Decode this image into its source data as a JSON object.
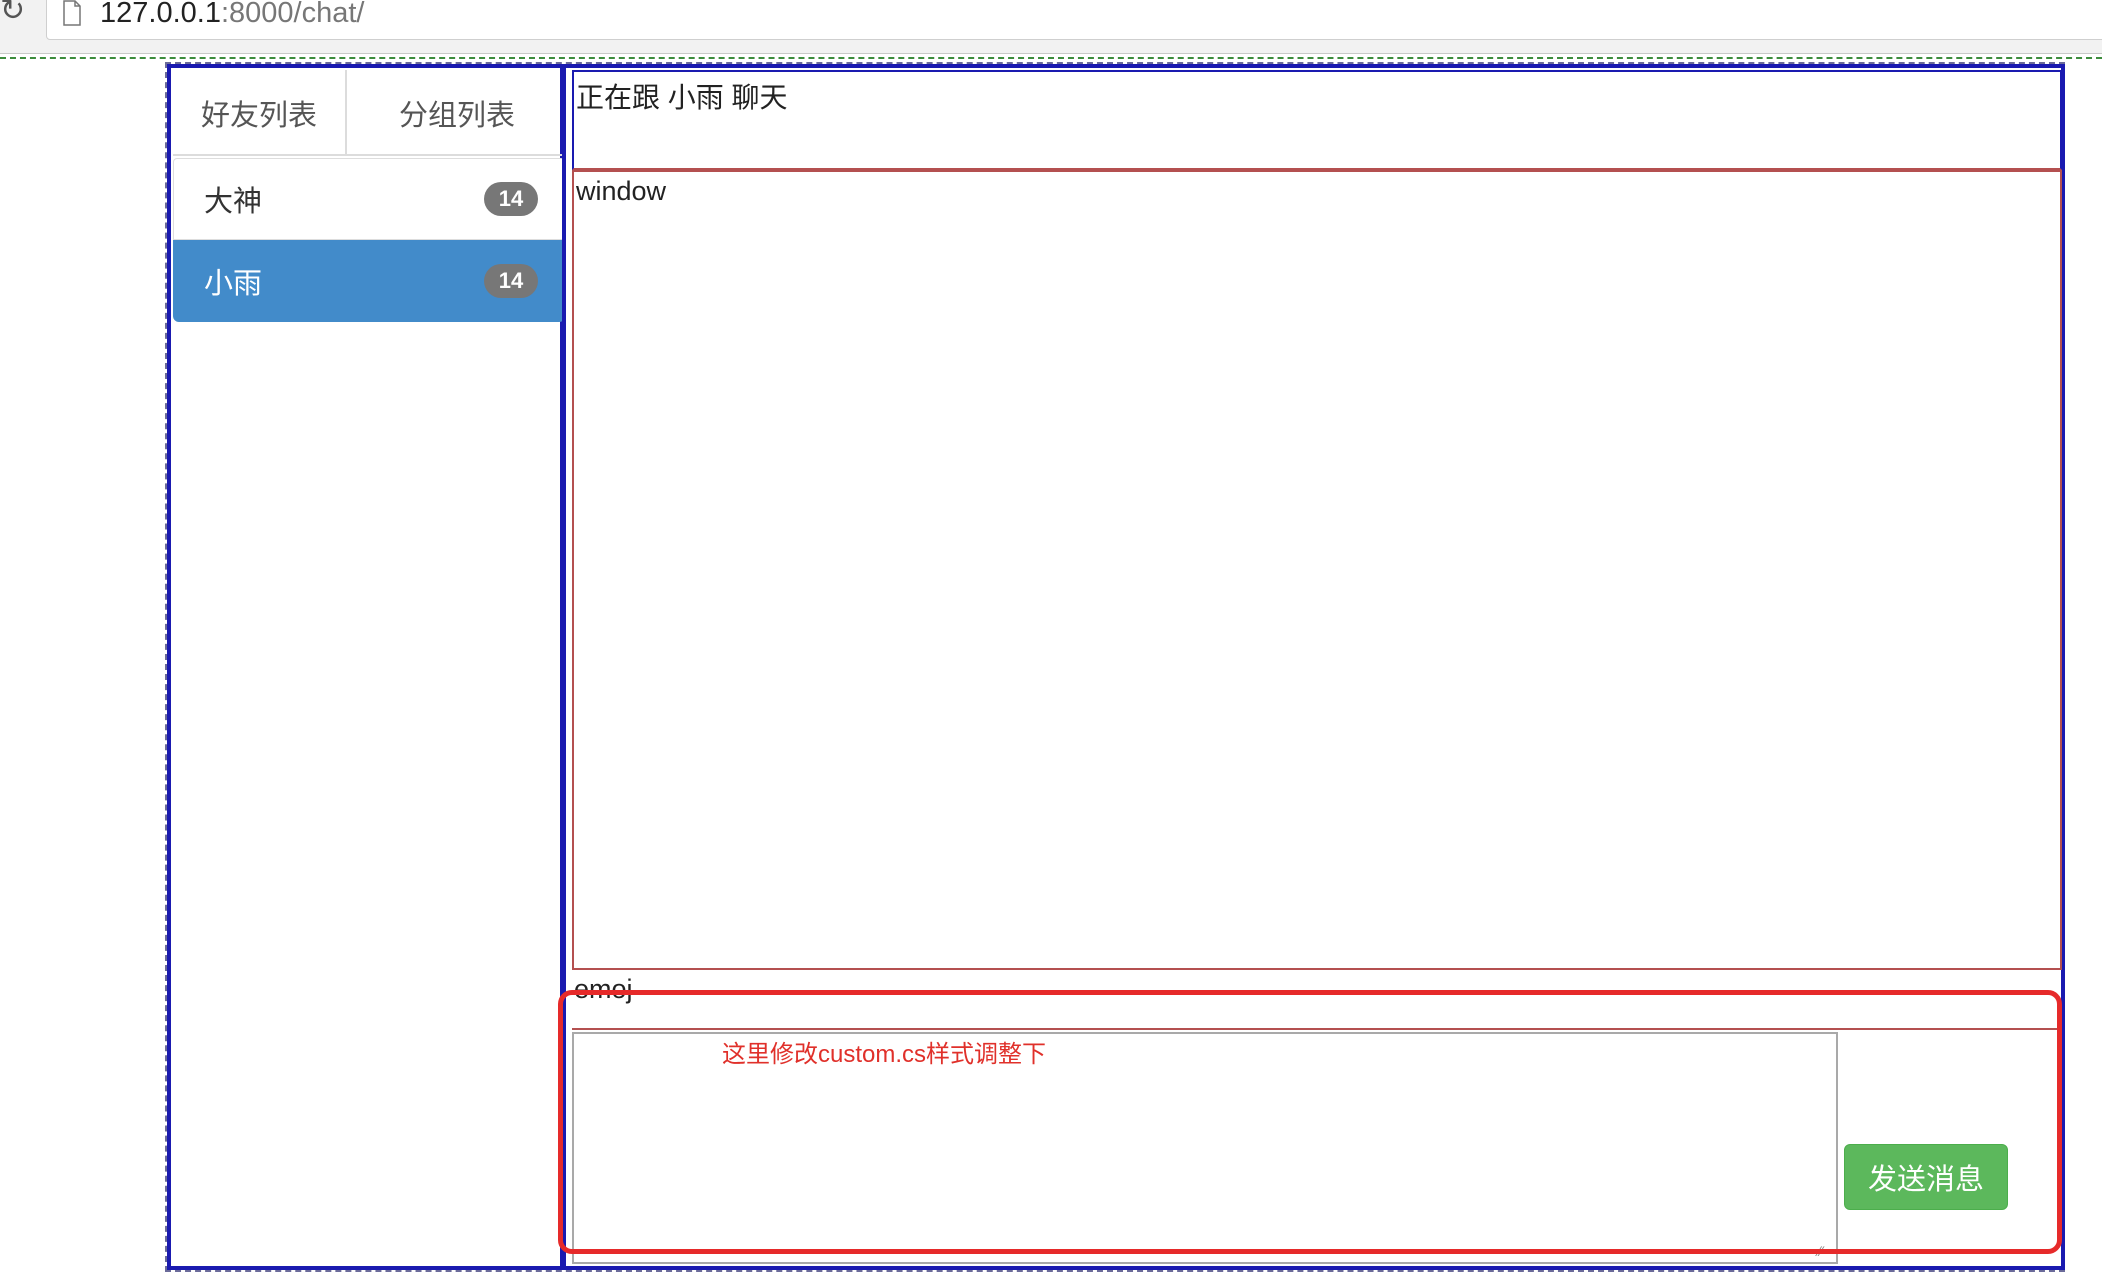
{
  "browser": {
    "url_host": "127.0.0.1",
    "url_rest": ":8000/chat/"
  },
  "sidebar": {
    "tabs": [
      {
        "label": "好友列表"
      },
      {
        "label": "分组列表"
      }
    ],
    "friends": [
      {
        "name": "大神",
        "count": "14"
      },
      {
        "name": "小雨",
        "count": "14",
        "active": true
      }
    ]
  },
  "chat": {
    "title": "正在跟 小雨 聊天",
    "window_label": "window",
    "emoji_label": "emoj",
    "annotation_note": "这里修改custom.cs样式调整下",
    "send_label": "发送消息"
  },
  "colors": {
    "active_item": "#428bca",
    "badge": "#777777",
    "send_button": "#5cb85c",
    "annotation": "#e62a2a",
    "panel_border": "#1a1ab0"
  }
}
